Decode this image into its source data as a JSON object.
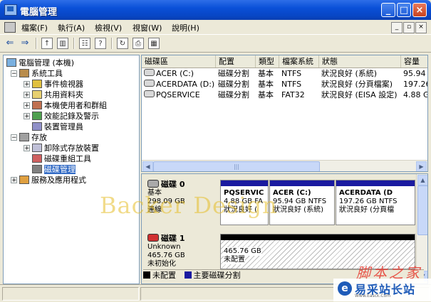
{
  "window": {
    "title": "電腦管理"
  },
  "menu": {
    "items": [
      "檔案(F)",
      "執行(A)",
      "檢視(V)",
      "視窗(W)",
      "說明(H)"
    ]
  },
  "toolbar": {
    "icons": [
      "back-arrow-icon",
      "forward-arrow-icon",
      "up-folder-icon",
      "show-hide-tree-icon",
      "properties-icon",
      "help-icon",
      "refresh-icon",
      "export-icon",
      "help-topic-icon"
    ]
  },
  "tree": {
    "root": "電腦管理 (本機)",
    "system_tools": "系統工具",
    "event_viewer": "事件檢視器",
    "shared_folders": "共用資料夾",
    "local_users": "本機使用者和群組",
    "performance": "效能記錄及警示",
    "device_manager": "裝置管理員",
    "storage": "存放",
    "removable": "卸除式存放裝置",
    "defrag": "磁碟重組工具",
    "disk_mgmt": "磁碟管理",
    "services": "服務及應用程式"
  },
  "volumes": {
    "headers": [
      "磁碟區",
      "配置",
      "類型",
      "檔案系統",
      "狀態",
      "容量"
    ],
    "rows": [
      [
        "ACER (C:)",
        "磁碟分割",
        "基本",
        "NTFS",
        "狀況良好 (系統)",
        "95.94"
      ],
      [
        "ACERDATA (D:)",
        "磁碟分割",
        "基本",
        "NTFS",
        "狀況良好 (分頁檔案)",
        "197.26"
      ],
      [
        "PQSERVICE",
        "磁碟分割",
        "基本",
        "FAT32",
        "狀況良好 (EISA 設定)",
        "4.88 G"
      ]
    ]
  },
  "disks": {
    "disk0": {
      "name": "磁碟 0",
      "type": "基本",
      "size": "298.09 GB",
      "status": "連線",
      "partitions": [
        {
          "name": "PQSERVIC",
          "size": "4.88 GB FA",
          "status": "狀況良好 ("
        },
        {
          "name": "ACER  (C:)",
          "size": "95.94 GB NTFS",
          "status": "狀況良好 (系統)"
        },
        {
          "name": "ACERDATA  (D",
          "size": "197.26 GB NTFS",
          "status": "狀況良好 (分頁檔"
        }
      ]
    },
    "disk1": {
      "name": "磁碟 1",
      "type": "Unknown",
      "size": "465.76 GB",
      "status": "未初始化",
      "partition": {
        "size": "465.76 GB",
        "status": "未配置"
      }
    }
  },
  "legend": {
    "unallocated": "未配置",
    "primary": "主要磁碟分割",
    "colors": {
      "unallocated": "#000000",
      "primary": "#1a1aa0"
    }
  },
  "watermarks": {
    "overlay": "Backer Design",
    "site_cn": "脚本之家",
    "brand": "易采站长站",
    "brand_sub": "Www.Easck.Com"
  }
}
